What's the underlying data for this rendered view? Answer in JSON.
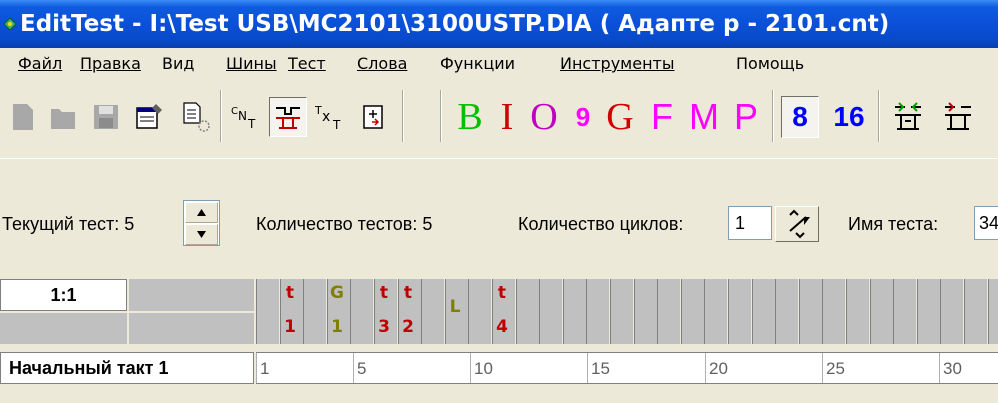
{
  "window": {
    "title": "EditTest - I:\\Test USB\\MC2101\\3100USTP.DIA ( Адапте р - 2101.cnt)"
  },
  "menu": [
    {
      "label": "Файл"
    },
    {
      "label": "Правка"
    },
    {
      "label": "Вид"
    },
    {
      "label": "Шины"
    },
    {
      "label": "Тест"
    },
    {
      "label": "Слова"
    },
    {
      "label": "Функции"
    },
    {
      "label": "Инструменты"
    },
    {
      "label": "Помощь"
    }
  ],
  "toolbar": {
    "icons": [
      "new-icon",
      "open-icon",
      "save-icon",
      "properties-icon",
      "export-icon",
      "cn-icon",
      "bus-icon",
      "tx-icon",
      "insert-icon"
    ],
    "letters": [
      {
        "label": "B",
        "color": "#00c000"
      },
      {
        "label": "I",
        "color": "#d00000"
      },
      {
        "label": "O",
        "color": "#c000c0"
      },
      {
        "label": "9",
        "color": "#ff00ff"
      },
      {
        "label": "G",
        "color": "#d00000"
      },
      {
        "label": "F",
        "color": "#ff00ff"
      },
      {
        "label": "M",
        "color": "#ff00ff"
      },
      {
        "label": "P",
        "color": "#ff00ff"
      }
    ],
    "radix": [
      {
        "label": "8",
        "color": "#0000ff"
      },
      {
        "label": "16",
        "color": "#0000ff"
      }
    ]
  },
  "params": {
    "current_test_label": "Текущий тест: 5",
    "test_count_label": "Количество тестов: 5",
    "cycles_label": "Количество циклов:",
    "cycles_value": "1",
    "test_name_label": "Имя теста:",
    "test_name_value": "34"
  },
  "grid": {
    "header_label": "1:1",
    "start_tact_label": "Начальный такт 1",
    "ticks": [
      "1",
      "5",
      "10",
      "15",
      "20",
      "25",
      "30"
    ],
    "marks": [
      {
        "top": "t",
        "bottom": "1",
        "color": "#c00000"
      },
      {
        "top": "G",
        "bottom": "1",
        "color": "#808000"
      },
      {
        "top": "t",
        "bottom": "3",
        "color": "#c00000"
      },
      {
        "top": "t",
        "bottom": "2",
        "color": "#c00000"
      },
      {
        "top": "L",
        "bottom": "",
        "color": "#808000"
      },
      {
        "top": "t",
        "bottom": "4",
        "color": "#c00000"
      }
    ]
  }
}
